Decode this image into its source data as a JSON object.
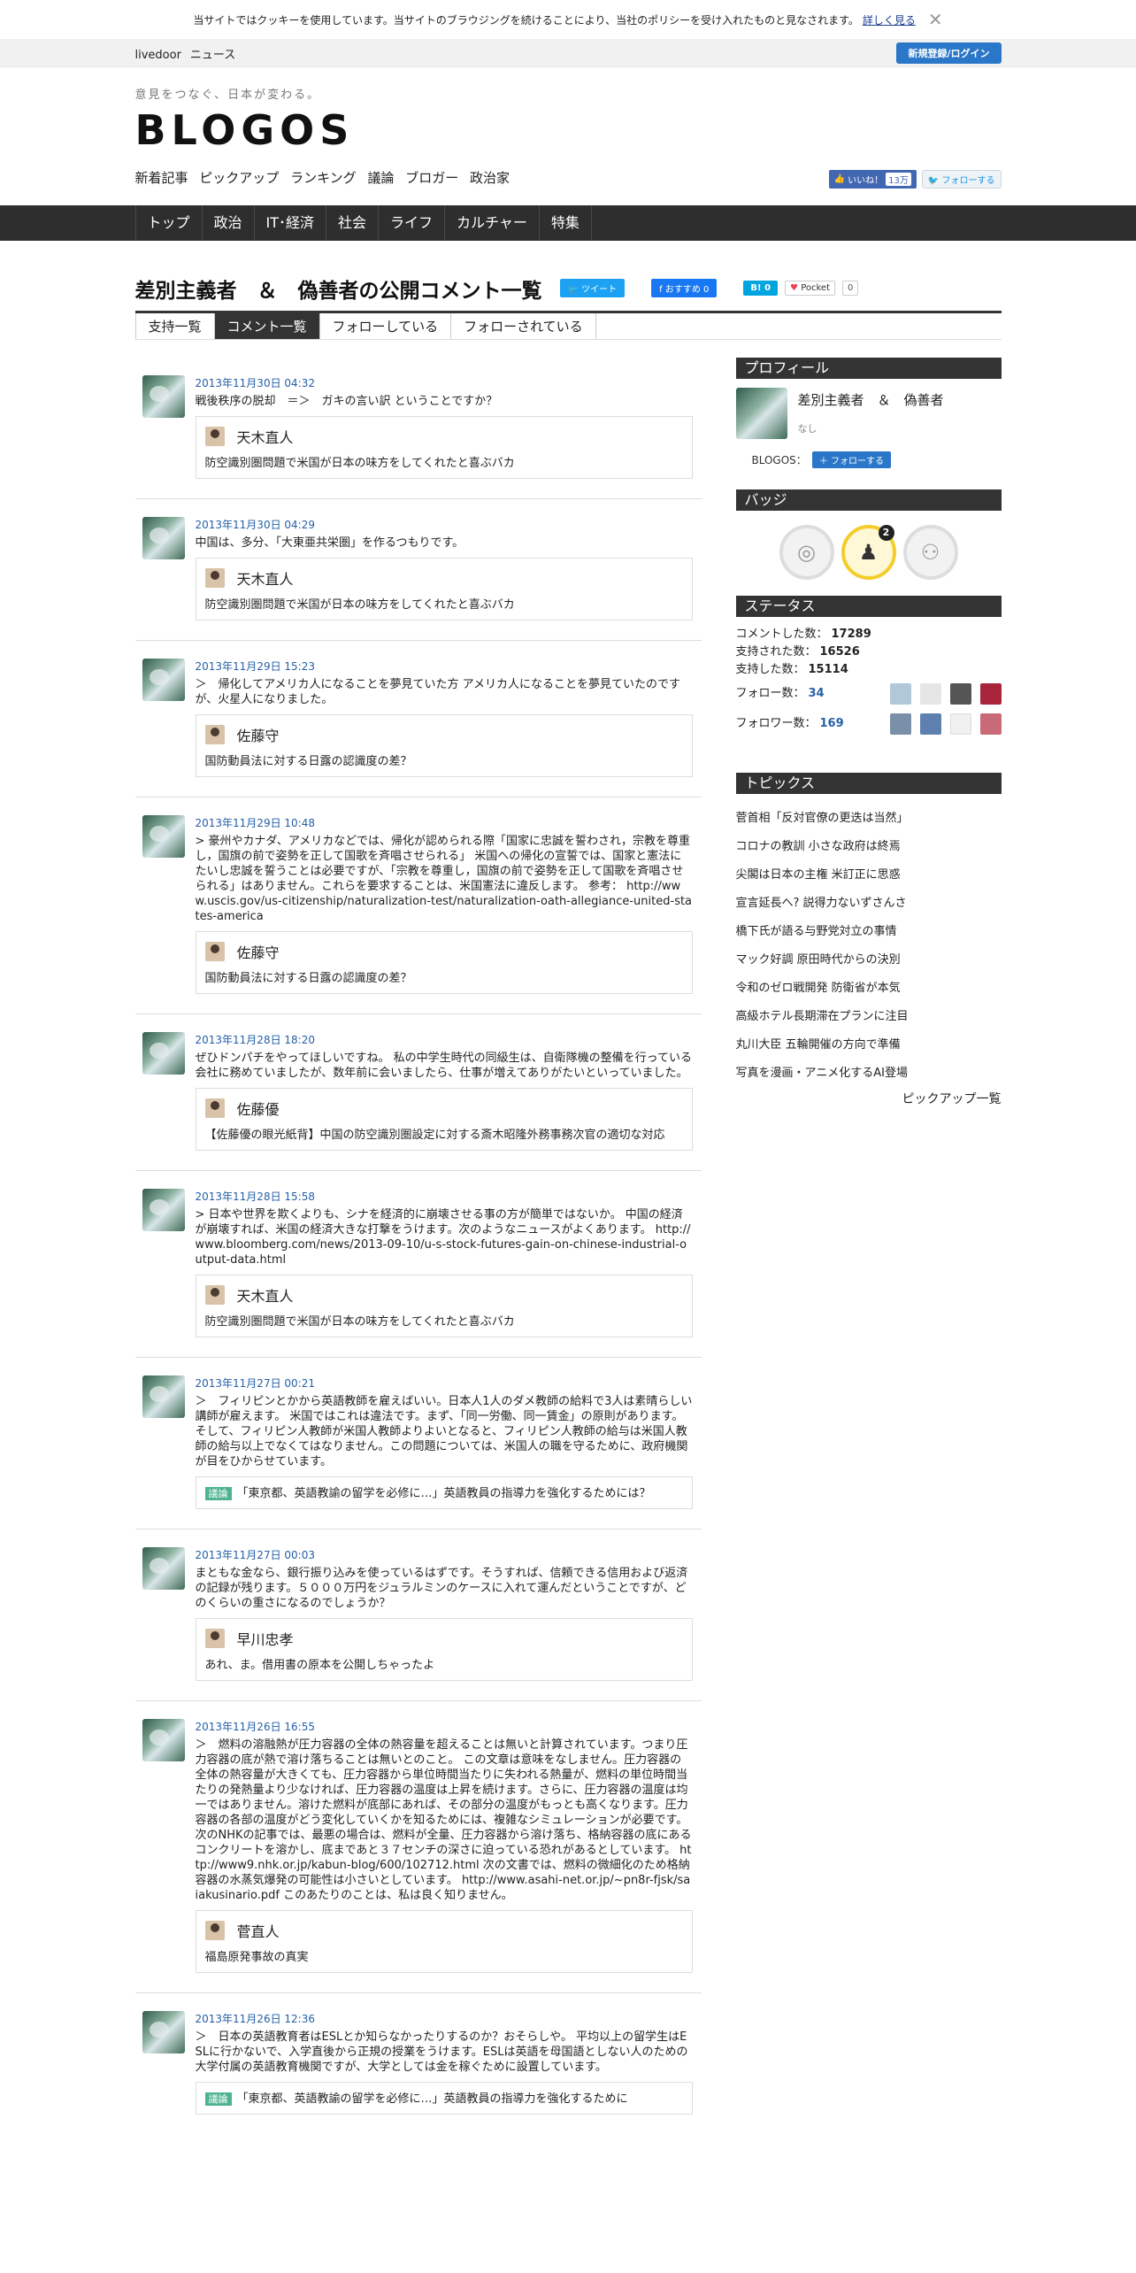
{
  "cookie": {
    "text": "当サイトではクッキーを使用しています。当サイトのブラウジングを続けることにより、当社のポリシーを受け入れたものと見なされます。",
    "more": "詳しく見る"
  },
  "topbar": {
    "brand1": "livedoor",
    "brand2": "ニュース",
    "login": "新規登録/ログイン"
  },
  "header": {
    "tagline": "意見をつなぐ、日本が変わる。",
    "logo": "BLOGOS",
    "subnav": [
      "新着記事",
      "ピックアップ",
      "ランキング",
      "議論",
      "ブロガー",
      "政治家"
    ],
    "fb_like": "いいね！",
    "fb_like_count": "13万",
    "tw_follow": "フォローする"
  },
  "mainnav": [
    "トップ",
    "政治",
    "IT･経済",
    "社会",
    "ライフ",
    "カルチャー",
    "特集"
  ],
  "page": {
    "title": "差別主義者　＆　偽善者の公開コメント一覧",
    "tweet": "ツイート",
    "fb_recommend": "おすすめ 0",
    "hatena": "B! 0",
    "pocket": "Pocket",
    "pocket_count": "0"
  },
  "tabs": [
    "支持一覧",
    "コメント一覧",
    "フォローしている",
    "フォローされている"
  ],
  "comments": [
    {
      "date": "2013年11月30日 04:32",
      "text": "戦後秩序の脱却　＝＞　ガキの言い訳 ということですか？",
      "author": "天木直人",
      "title": "防空識別圏問題で米国が日本の味方をしてくれたと喜ぶバカ"
    },
    {
      "date": "2013年11月30日 04:29",
      "text": "中国は、多分、「大東亜共栄圏」を作るつもりです。",
      "author": "天木直人",
      "title": "防空識別圏問題で米国が日本の味方をしてくれたと喜ぶバカ"
    },
    {
      "date": "2013年11月29日 15:23",
      "text": "＞　帰化してアメリカ人になることを夢見ていた方 アメリカ人になることを夢見ていたのですが、火星人になりました。",
      "author": "佐藤守",
      "title": "国防動員法に対する日露の認識度の差？"
    },
    {
      "date": "2013年11月29日 10:48",
      "text": "> 豪州やカナダ、アメリカなどでは、帰化が認められる際「国家に忠誠を誓わされ，宗教を尊重し，国旗の前で姿勢を正して国歌を斉唱させられる」 米国への帰化の宣誓では、国家と憲法にたいし忠誠を誓うことは必要ですが、「宗教を尊重し，国旗の前で姿勢を正して国歌を斉唱させられる」はありません。これらを要求することは、米国憲法に違反します。 参考： http://www.uscis.gov/us-citizenship/naturalization-test/naturalization-oath-allegiance-united-states-america",
      "author": "佐藤守",
      "title": "国防動員法に対する日露の認識度の差？"
    },
    {
      "date": "2013年11月28日 18:20",
      "text": "ぜひドンパチをやってほしいですね。 私の中学生時代の同級生は、自衛隊機の整備を行っている会社に務めていましたが、数年前に会いましたら、仕事が増えてありがたいといっていました。",
      "author": "佐藤優",
      "title": "【佐藤優の眼光紙背】中国の防空識別圏設定に対する斎木昭隆外務事務次官の適切な対応"
    },
    {
      "date": "2013年11月28日 15:58",
      "text": "> 日本や世界を欺くよりも、シナを経済的に崩壊させる事の方が簡単ではないか。 中国の経済が崩壊すれば、米国の経済大きな打撃をうけます。次のようなニュースがよくあります。 http://www.bloomberg.com/news/2013-09-10/u-s-stock-futures-gain-on-chinese-industrial-output-data.html",
      "author": "天木直人",
      "title": "防空識別圏問題で米国が日本の味方をしてくれたと喜ぶバカ"
    },
    {
      "date": "2013年11月27日 00:21",
      "text": "＞　フィリピンとかから英語教師を雇えばいい。日本人1人のダメ教師の給料で3人は素晴らしい講師が雇えます。 米国ではこれは違法です。まず、「同一労働、同一賃金」の原則があります。そして、フィリピン人教師が米国人教師よりよいとなると、フィリピン人教師の給与は米国人教師の給与以上でなくてはなりません。この問題については、米国人の職を守るために、政府機関が目をひからせています。",
      "author": "",
      "tag": "議論",
      "title": "「東京都、英語教諭の留学を必修に…」英語教員の指導力を強化するためには？"
    },
    {
      "date": "2013年11月27日 00:03",
      "text": "まともな金なら、銀行振り込みを使っているはずです。そうすれば、信頼できる信用および返済の記録が残ります。５０００万円をジュラルミンのケースに入れて運んだということですが、どのくらいの重さになるのでしょうか？",
      "author": "早川忠孝",
      "title": "あれ、ま。借用書の原本を公開しちゃったよ"
    },
    {
      "date": "2013年11月26日 16:55",
      "text": "＞　燃料の溶融熱が圧力容器の全体の熱容量を超えることは無いと計算されています。つまり圧力容器の底が熱で溶け落ちることは無いとのこと。 この文章は意味をなしません。圧力容器の全体の熱容量が大きくても、圧力容器から単位時間当たりに失われる熱量が、燃料の単位時間当たりの発熱量より少なければ、圧力容器の温度は上昇を続けます。さらに、圧力容器の温度は均一ではありません。溶けた燃料が底部にあれば、その部分の温度がもっとも高くなります。圧力容器の各部の温度がどう変化していくかを知るためには、複雑なシミュレーションが必要です。 次のNHKの記事では、最悪の場合は、燃料が全量、圧力容器から溶け落ち、格納容器の底にあるコンクリートを溶かし、底まであと３７センチの深さに迫っている恐れがあるとしています。 http://www9.nhk.or.jp/kabun-blog/600/102712.html 次の文書では、燃料の微細化のため格納容器の水蒸気爆発の可能性は小さいとしています。 http://www.asahi-net.or.jp/~pn8r-fjsk/saiakusinario.pdf このあたりのことは、私は良く知りません。",
      "author": "菅直人",
      "title": "福島原発事故の真実"
    },
    {
      "date": "2013年11月26日 12:36",
      "text": "＞　日本の英語教育者はESLとか知らなかったりするのか？おそらしや。 平均以上の留学生はESLに行かないで、入学直後から正規の授業をうけます。ESLは英語を母国語としない人のための大学付属の英語教育機関ですが、大学としては金を稼ぐために設置しています。",
      "author": "",
      "tag": "議論",
      "title": "「東京都、英語教諭の留学を必修に…」英語教員の指導力を強化するために"
    }
  ],
  "sidebar": {
    "profile_head": "プロフィール",
    "profile_name": "差別主義者　＆　偽善者",
    "profile_desc": "なし",
    "blogos_label": "BLOGOS：",
    "follow": "フォローする",
    "badge_head": "バッジ",
    "badge_count": "2",
    "status_head": "ステータス",
    "stats": [
      {
        "label": "コメントした数：",
        "value": "17289"
      },
      {
        "label": "支持された数：",
        "value": "16526"
      },
      {
        "label": "支持した数：",
        "value": "15114"
      },
      {
        "label": "フォロー数：",
        "value": "34"
      },
      {
        "label": "フォロワー数：",
        "value": "169"
      }
    ],
    "topics_head": "トピックス",
    "topics": [
      "菅首相「反対官僚の更迭は当然」",
      "コロナの教訓 小さな政府は終焉",
      "尖閣は日本の主権 米訂正に思惑",
      "宣言延長へ? 説得力ないずさんさ",
      "橋下氏が語る与野党対立の事情",
      "マック好調 原田時代からの決別",
      "令和のゼロ戦開発 防衛省が本気",
      "高級ホテル長期滞在プランに注目",
      "丸川大臣 五輪開催の方向で準備",
      "写真を漫画・アニメ化するAI登場"
    ],
    "pickup_list": "ピックアップ一覧"
  }
}
